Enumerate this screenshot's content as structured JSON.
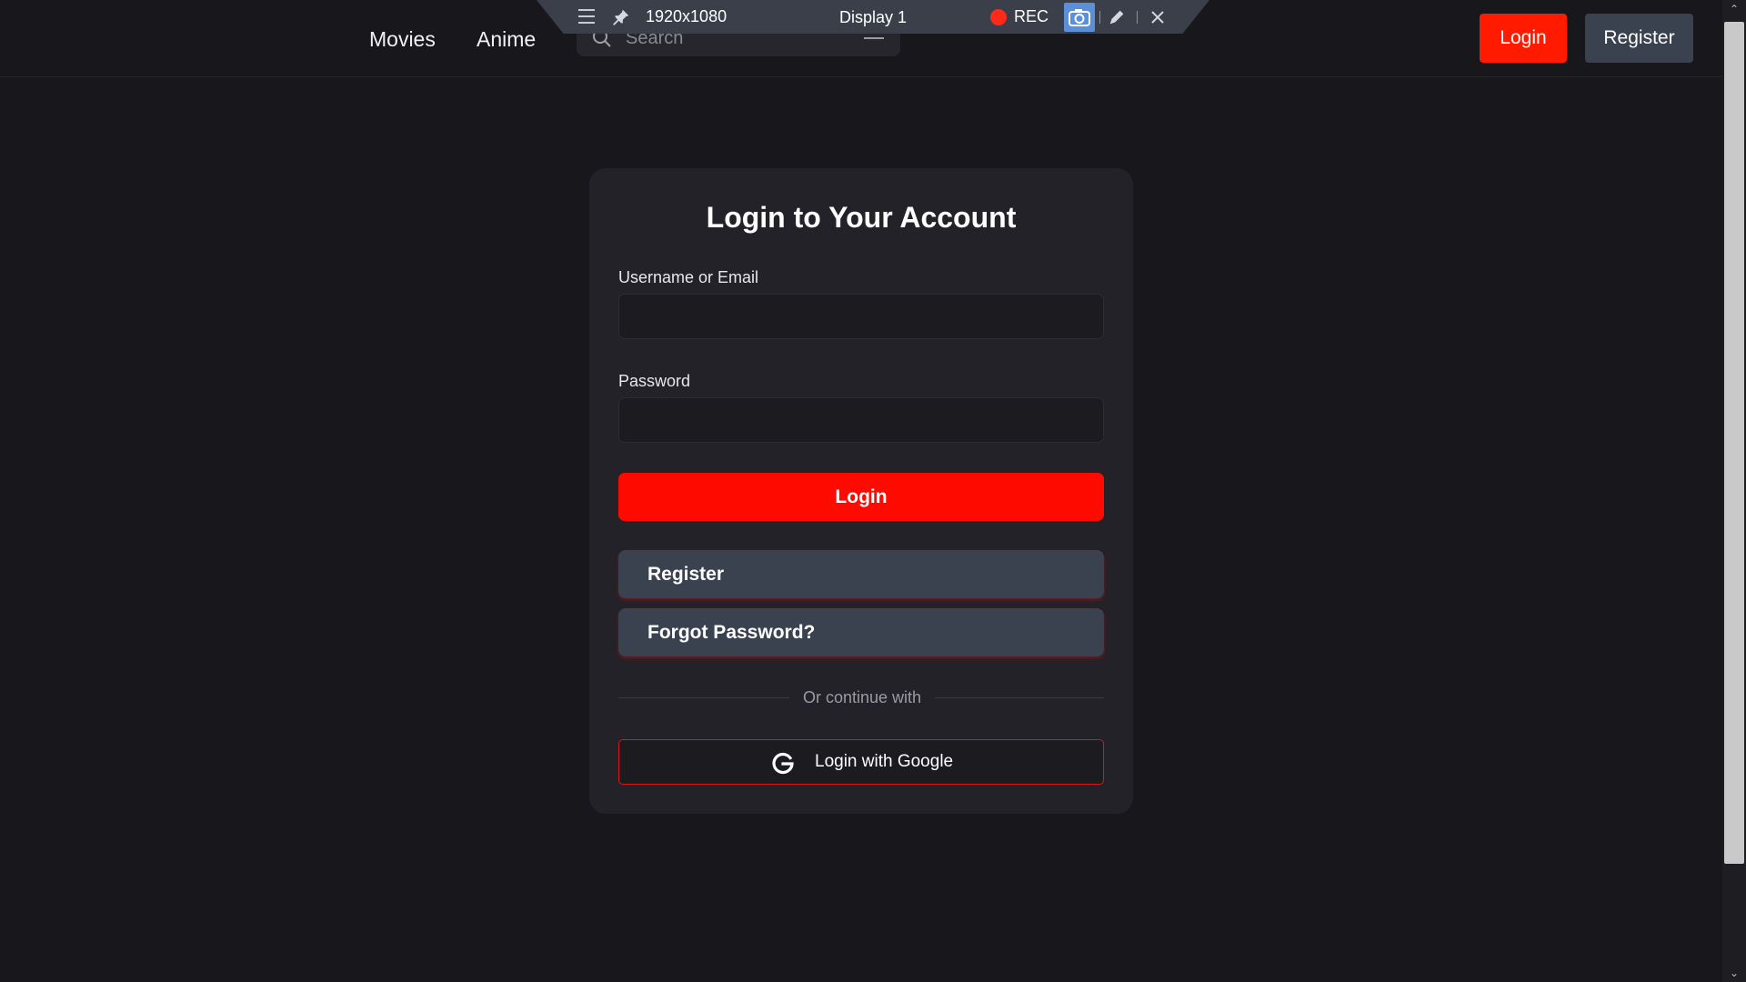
{
  "header": {
    "nav": [
      {
        "label": "Movies"
      },
      {
        "label": "Anime"
      }
    ],
    "search": {
      "placeholder": "Search",
      "value": ""
    },
    "login_label": "Login",
    "register_label": "Register"
  },
  "recorder": {
    "resolution": "1920x1080",
    "display": "Display 1",
    "rec_label": "REC"
  },
  "login_card": {
    "title": "Login to Your Account",
    "username_label": "Username or Email",
    "username_value": "",
    "password_label": "Password",
    "password_value": "",
    "login_button": "Login",
    "register_button": "Register",
    "forgot_button": "Forgot Password?",
    "divider_text": "Or continue with",
    "google_button": "Login with Google"
  },
  "colors": {
    "background": "#18181c",
    "card": "#222228",
    "accent_red": "#ff0a00",
    "secondary_button": "#3a4250"
  },
  "icons": [
    "search-icon",
    "filter-icon",
    "menu-icon",
    "pin-icon",
    "record-dot-icon",
    "camera-icon",
    "pencil-icon",
    "close-icon",
    "google-icon",
    "chevron-up-icon",
    "chevron-down-icon"
  ]
}
